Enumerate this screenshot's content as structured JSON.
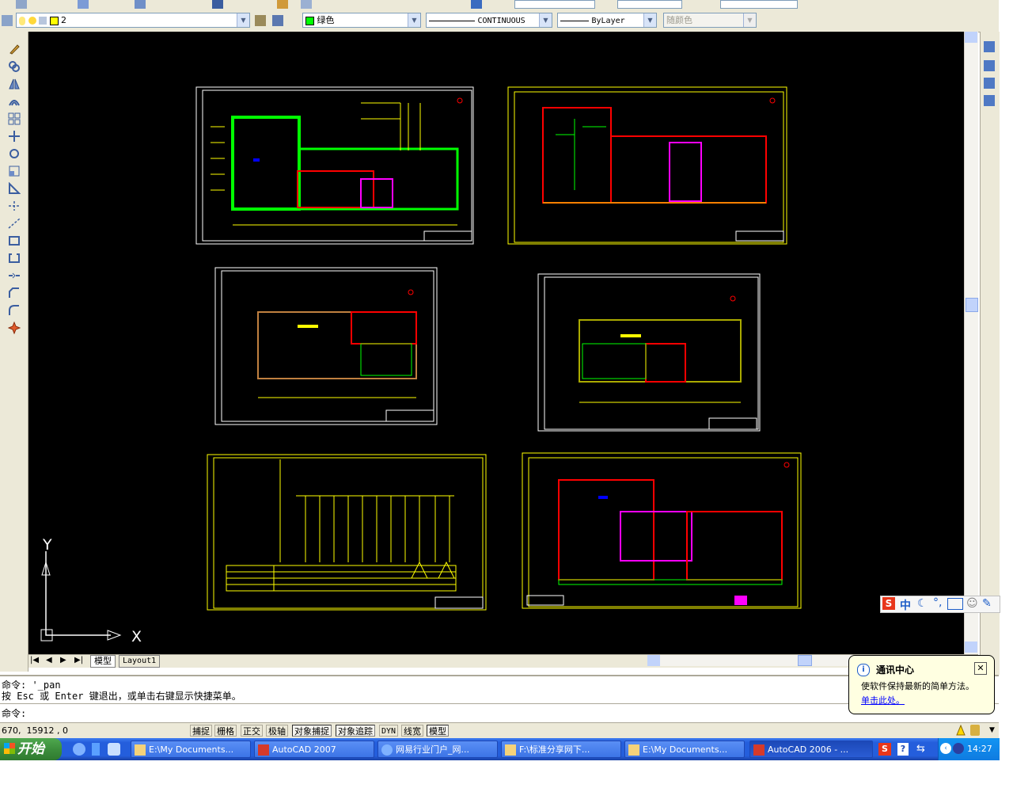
{
  "layer_toolbar": {
    "layer_name": "2",
    "color": "绿色",
    "linetype": "CONTINUOUS",
    "lineweight": "ByLayer",
    "plotstyle": "随颜色"
  },
  "tabs": {
    "model": "模型",
    "layout1": "Layout1"
  },
  "ucs": {
    "y_label": "Y",
    "x_label": "X"
  },
  "command": {
    "line1": "命令: '_pan",
    "line2": "按 Esc 或 Enter 键退出，或单击右键显示快捷菜单。",
    "prompt": "命令:"
  },
  "status": {
    "coords": "670,  15912 , 0",
    "buttons": [
      "捕捉",
      "栅格",
      "正交",
      "极轴",
      "对象捕捉",
      "对象追踪",
      "DYN",
      "线宽",
      "模型"
    ]
  },
  "balloon": {
    "title": "通讯中心",
    "body": "使软件保持最新的简单方法。",
    "link": "单击此处。"
  },
  "taskbar": {
    "start": "开始",
    "tasks": [
      "E:\\My Documents...",
      "AutoCAD 2007",
      "网易行业门户_网...",
      "F:\\标准分享网下...",
      "E:\\My Documents...",
      "AutoCAD 2006 - ..."
    ],
    "clock": "14:27"
  },
  "ime": {
    "label": "中"
  },
  "colors": {
    "drawing_bg": "#000000",
    "frame_white": "#ffffff",
    "frame_yellow": "#ffff00",
    "wall_green": "#00ff00",
    "wall_red": "#ff0000",
    "magenta": "#ff00ff",
    "taskbar_blue": "#245edc"
  }
}
